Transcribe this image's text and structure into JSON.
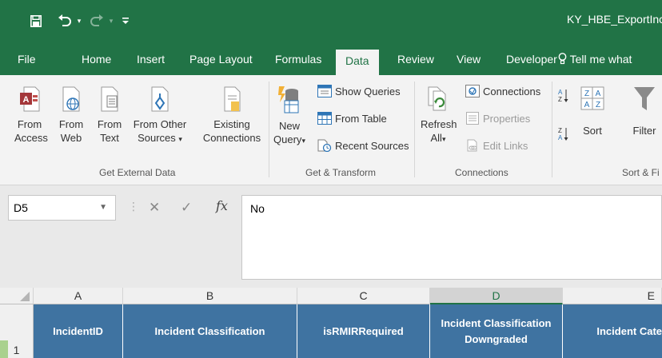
{
  "app": {
    "document_title": "KY_HBE_ExportInci",
    "quick_access": {
      "save_icon": "save-icon",
      "undo_icon": "undo-icon",
      "redo_icon": "redo-icon",
      "customize_icon": "customize-qat-icon"
    }
  },
  "tabs": [
    {
      "label": "File"
    },
    {
      "label": "Home"
    },
    {
      "label": "Insert"
    },
    {
      "label": "Page Layout"
    },
    {
      "label": "Formulas"
    },
    {
      "label": "Data",
      "active": true
    },
    {
      "label": "Review"
    },
    {
      "label": "View"
    },
    {
      "label": "Developer"
    }
  ],
  "tell_me": "Tell me what",
  "ribbon": {
    "get_external_data": {
      "label": "Get External Data",
      "from_access": [
        "From",
        "Access"
      ],
      "from_web": [
        "From",
        "Web"
      ],
      "from_text": [
        "From",
        "Text"
      ],
      "from_other": [
        "From Other",
        "Sources"
      ],
      "existing": [
        "Existing",
        "Connections"
      ]
    },
    "get_transform": {
      "label": "Get & Transform",
      "new_query": [
        "New",
        "Query"
      ],
      "show_queries": "Show Queries",
      "from_table": "From Table",
      "recent_sources": "Recent Sources"
    },
    "connections": {
      "label": "Connections",
      "refresh": [
        "Refresh",
        "All"
      ],
      "connections": "Connections",
      "properties": "Properties",
      "edit_links": "Edit Links"
    },
    "sort_filter": {
      "label": "Sort & Fi",
      "sort": "Sort",
      "filter": "Filter"
    }
  },
  "formula_bar": {
    "name_box": "D5",
    "fx": "fx",
    "value": "No"
  },
  "grid": {
    "columns": [
      "A",
      "B",
      "C",
      "D",
      "E"
    ],
    "selected_column": "D",
    "row_number": "1",
    "header_cells": [
      [
        "IncidentID"
      ],
      [
        "Incident Classification"
      ],
      [
        "isRMIRRequired"
      ],
      [
        "Incident Classification",
        "Downgraded"
      ],
      [
        "Incident Cate"
      ]
    ]
  },
  "colors": {
    "excel_green": "#217346",
    "header_fill": "#3f73a1"
  }
}
